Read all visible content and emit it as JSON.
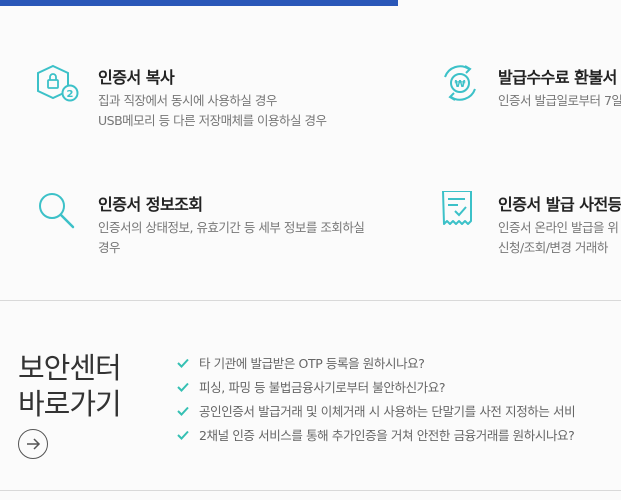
{
  "colors": {
    "accent": "#2a57b8",
    "icon_teal": "#3cc1c8",
    "check_teal": "#35c0b3"
  },
  "services": [
    {
      "icon": "certificate-copy-icon",
      "title": "인증서 복사",
      "desc": "집과 직장에서 동시에 사용하실 경우\nUSB메모리 등 다른 저장매체를 이용하실 경우"
    },
    {
      "icon": "fee-refund-icon",
      "title": "발급수수료 환불서",
      "desc": "인증서 발급일로부터 7일"
    },
    {
      "icon": "search-icon",
      "title": "인증서 정보조회",
      "desc": "인증서의 상태정보, 유효기간 등 세부 정보를 조회하실\n경우"
    },
    {
      "icon": "document-check-icon",
      "title": "인증서 발급 사전등",
      "desc": "인증서 온라인 발급을 위\n신청/조회/변경 거래하"
    }
  ],
  "security": {
    "title": "보안센터\n바로가기",
    "items": [
      "타 기관에 발급받은 OTP 등록을 원하시나요?",
      "피싱, 파밍 등 불법금융사기로부터 불안하신가요?",
      "공인인증서 발급거래 및 이체거래 시 사용하는 단말기를 사전 지정하는 서비",
      "2채널 인증 서비스를 통해 추가인증을 거쳐 안전한 금융거래를 원하시나요?"
    ]
  }
}
